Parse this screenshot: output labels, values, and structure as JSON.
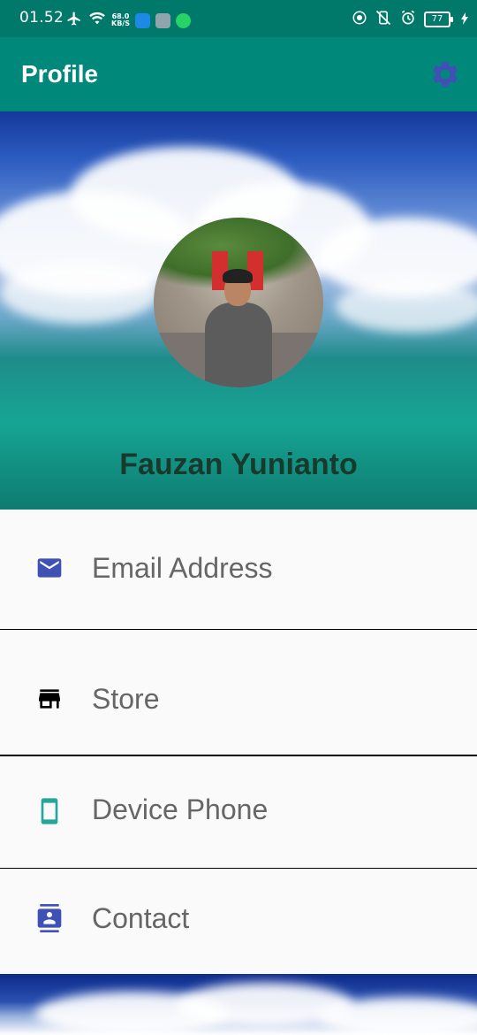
{
  "status_bar": {
    "time": "01.52",
    "net_speed_value": "68.0",
    "net_speed_unit": "KB/S",
    "battery": "77"
  },
  "app_bar": {
    "title": "Profile",
    "settings_icon": "gear-icon"
  },
  "profile": {
    "name": "Fauzan Yunianto"
  },
  "menu": {
    "items": [
      {
        "label": "Email Address",
        "icon": "email-icon",
        "color": "#3f51b5"
      },
      {
        "label": "Store",
        "icon": "store-icon",
        "color": "#000000"
      },
      {
        "label": "Device Phone",
        "icon": "phone-icon",
        "color": "#26a69a"
      },
      {
        "label": "Contact",
        "icon": "contact-icon",
        "color": "#3f51b5"
      }
    ]
  },
  "colors": {
    "primary": "#00897b",
    "primary_dark": "#00796b",
    "accent": "#3f51b5"
  }
}
